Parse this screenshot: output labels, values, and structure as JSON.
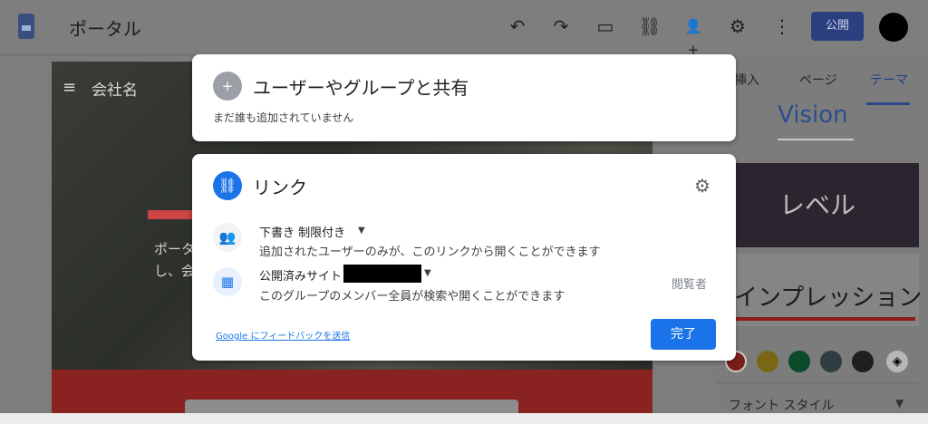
{
  "app": {
    "title": "ポータル"
  },
  "toolbar": {
    "undo_icon": "↶",
    "redo_icon": "↷",
    "preview_icon": "▭",
    "link_icon": "⛓",
    "add_user_icon": "👤+",
    "settings_icon": "⚙",
    "more_icon": "⋮",
    "publish_label": "公開"
  },
  "preview": {
    "menu_icon": "≡",
    "company_name": "会社名",
    "partial_text_line1": "ポータ",
    "partial_text_line2": "し、会"
  },
  "right_panel": {
    "tabs": [
      "挿入",
      "ページ",
      "テーマ"
    ],
    "active_tab": "テーマ",
    "theme_vision": "Vision",
    "theme_level": "レベル",
    "theme_impression": "インプレッション",
    "swatches": [
      "#c0392b",
      "#c9a917",
      "#0b7a3e",
      "#4a5f66",
      "#2f2f2f"
    ],
    "font_style_label": "フォント スタイル"
  },
  "share_card": {
    "title": "ユーザーやグループと共有",
    "subtitle": "まだ誰も追加されていません"
  },
  "link_card": {
    "title": "リンク",
    "draft_label": "下書き 制限付き",
    "draft_desc": "追加されたユーザーのみが、このリンクから開くことができます",
    "published_label": "公開済みサイト",
    "published_desc": "このグループのメンバー全員が検索や開くことができます",
    "viewer_label": "閲覧者",
    "feedback_link": "Google にフィードバックを送信",
    "done_label": "完了"
  }
}
